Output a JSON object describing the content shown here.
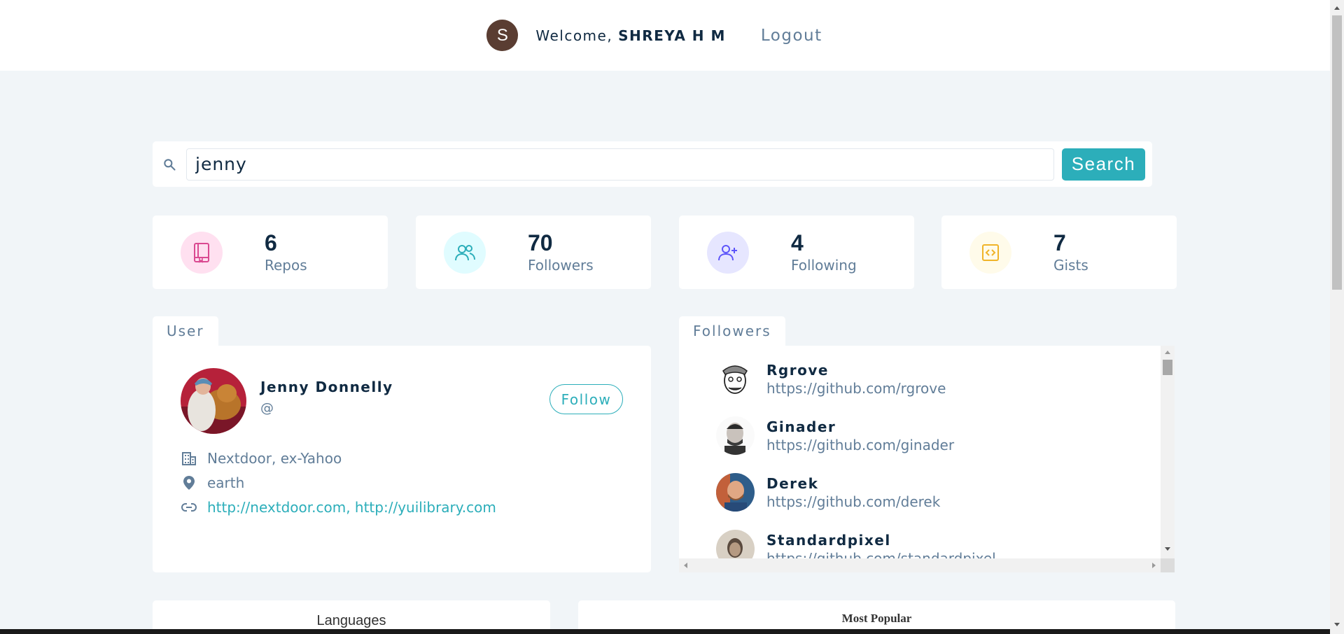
{
  "nav": {
    "avatar_letter": "S",
    "welcome_prefix": "Welcome, ",
    "user_name": "SHREYA H M",
    "logout_label": "Logout"
  },
  "search": {
    "value": "jenny",
    "button_label": "Search"
  },
  "stats": [
    {
      "value": "6",
      "label": "Repos",
      "icon": "repo-book-icon",
      "color": "#da4a91",
      "bg": "#ffe0f0"
    },
    {
      "value": "70",
      "label": "Followers",
      "icon": "users-icon",
      "color": "#2caeba",
      "bg": "#e0fcff"
    },
    {
      "value": "4",
      "label": "Following",
      "icon": "user-plus-icon",
      "color": "#5d55fa",
      "bg": "#e6e6ff"
    },
    {
      "value": "7",
      "label": "Gists",
      "icon": "code-icon",
      "color": "#f0b429",
      "bg": "#fffbea"
    }
  ],
  "user_card": {
    "tab_label": "User",
    "name": "Jenny Donnelly",
    "handle": "@",
    "follow_label": "Follow",
    "company": "Nextdoor, ex-Yahoo",
    "location": "earth",
    "blog": "http://nextdoor.com, http://yuilibrary.com"
  },
  "followers_card": {
    "tab_label": "Followers",
    "items": [
      {
        "name": "Rgrove",
        "url": "https://github.com/rgrove"
      },
      {
        "name": "Ginader",
        "url": "https://github.com/ginader"
      },
      {
        "name": "Derek",
        "url": "https://github.com/derek"
      },
      {
        "name": "Standardpixel",
        "url": "https://github.com/standardpixel"
      }
    ]
  },
  "bottom": {
    "languages_title": "Languages",
    "popular_title": "Most Popular"
  },
  "colors": {
    "accent": "#2caeba",
    "background": "#f1f5f8",
    "text_dark": "#102a42",
    "text_muted": "#617d98"
  }
}
